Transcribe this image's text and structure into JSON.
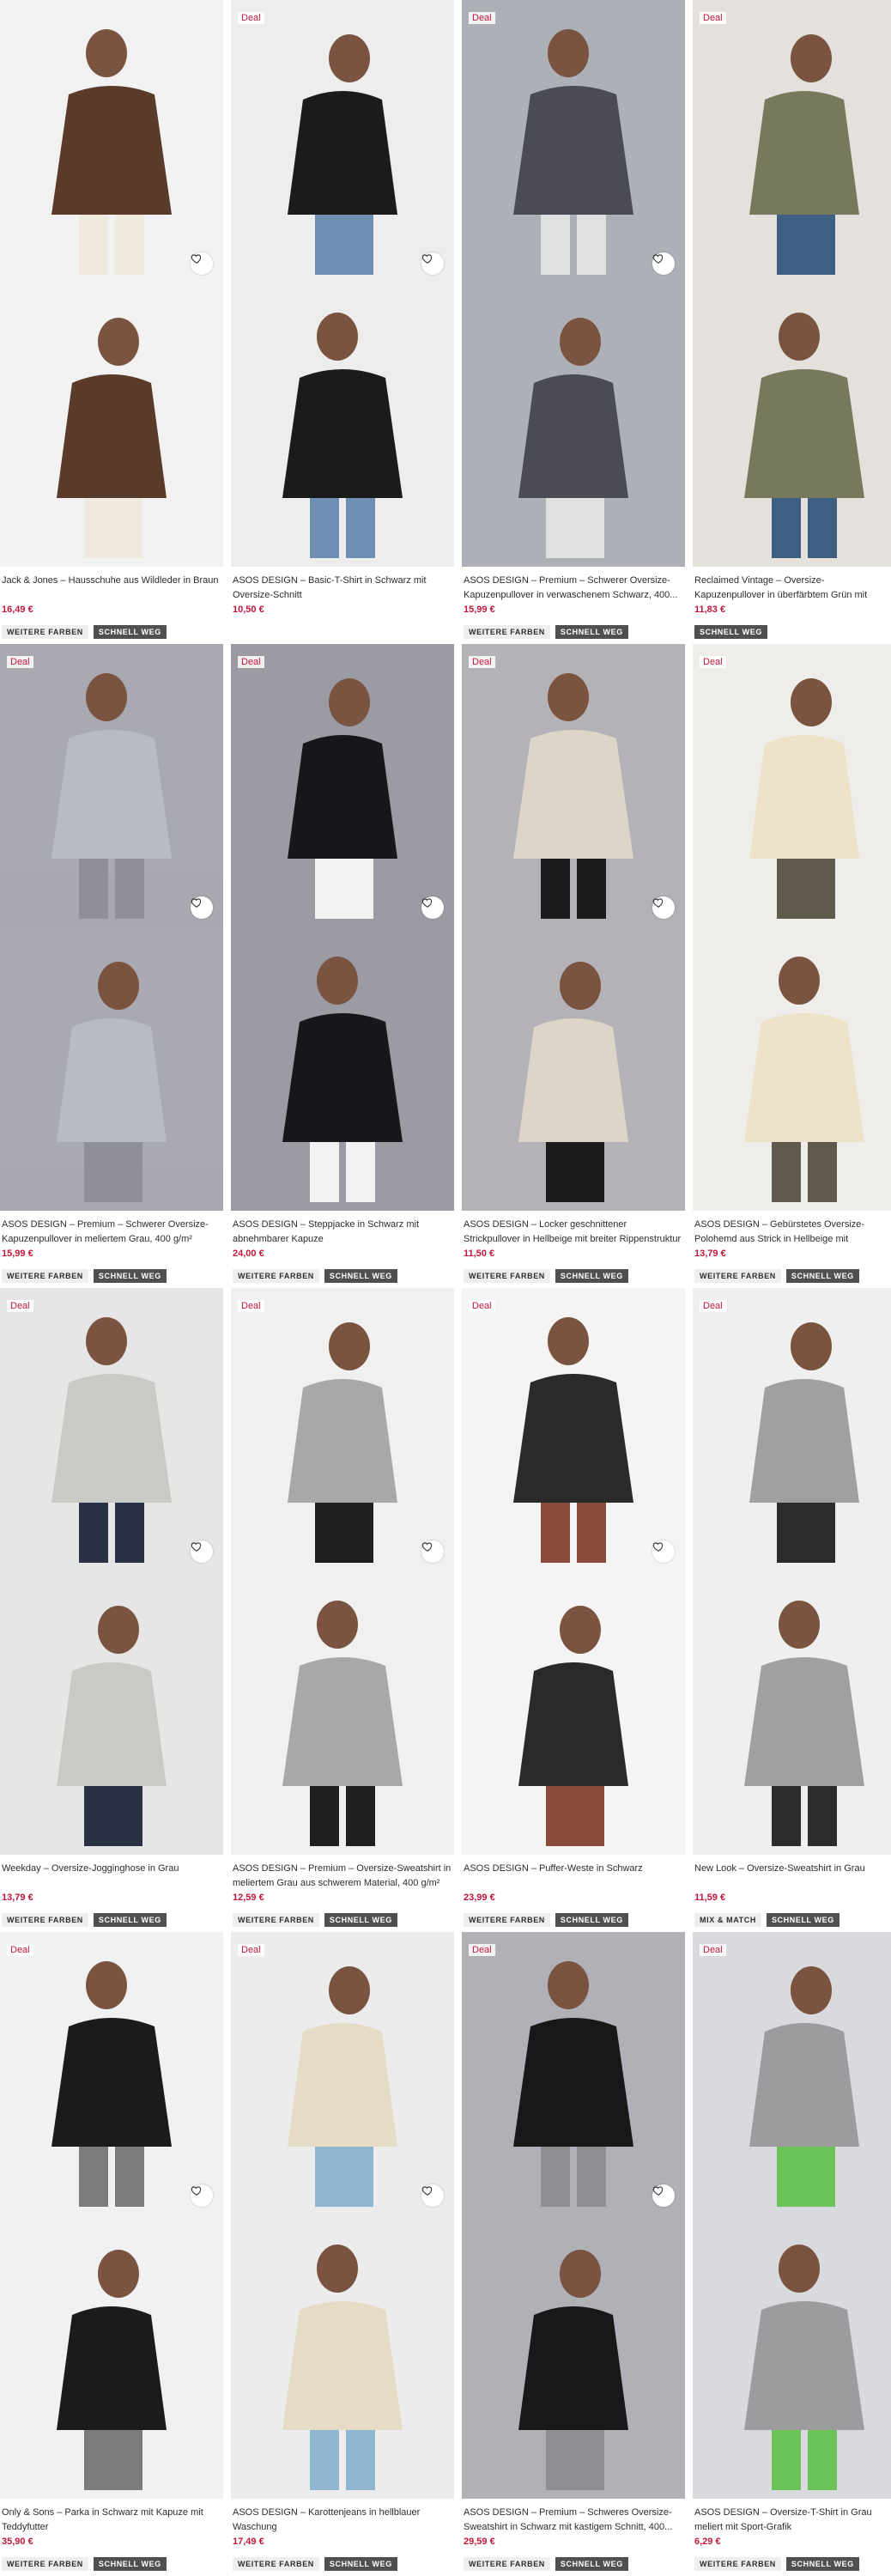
{
  "labels": {
    "deal": "Deal",
    "more_colors": "WEITERE FARBEN",
    "fast": "SCHNELL WEG",
    "mix_match": "MIX & MATCH"
  },
  "icons": {
    "wishlist": "heart-outline-icon"
  },
  "colors": {
    "price": "#c0183b",
    "deal": "#c0183b",
    "badge_dark": "#505050",
    "badge_light": "#eeeeee"
  },
  "products": [
    {
      "name": "Jack & Jones – Hausschuhe aus Wildleder in Braun",
      "price": "16,49 €",
      "deal": false,
      "badges": [
        "more_colors",
        "fast"
      ]
    },
    {
      "name": "ASOS DESIGN – Basic-T-Shirt in Schwarz mit Oversize-Schnitt",
      "price": "10,50 €",
      "deal": true,
      "badges": []
    },
    {
      "name": "ASOS DESIGN – Premium – Schwerer Oversize-Kapuzenpullover in verwaschenem Schwarz, 400...",
      "price": "15,99 €",
      "deal": true,
      "badges": [
        "more_colors",
        "fast"
      ]
    },
    {
      "name": "Reclaimed Vintage – Oversize-Kapuzenpullover in überfärbtem Grün mit Unisex-Schnitt",
      "price": "11,83 €",
      "deal": true,
      "badges": [
        "fast"
      ]
    },
    {
      "name": "ASOS DESIGN – Premium – Schwerer Oversize-Kapuzenpullover in meliertem Grau, 400 g/m²",
      "price": "15,99 €",
      "deal": true,
      "badges": [
        "more_colors",
        "fast"
      ]
    },
    {
      "name": "ASOS DESIGN – Steppjacke in Schwarz mit abnehmbarer Kapuze",
      "price": "24,00 €",
      "deal": true,
      "badges": [
        "more_colors",
        "fast"
      ]
    },
    {
      "name": "ASOS DESIGN – Locker geschnittener Strickpullover in Hellbeige mit breiter Rippenstruktur",
      "price": "11,50 €",
      "deal": true,
      "badges": [
        "more_colors",
        "fast"
      ]
    },
    {
      "name": "ASOS DESIGN – Gebürstetes Oversize-Polohemd aus Strick in Hellbeige mit Einkerbung am Ausschnitt",
      "price": "13,79 €",
      "deal": true,
      "badges": [
        "more_colors",
        "fast"
      ]
    },
    {
      "name": "Weekday – Oversize-Jogginghose in Grau",
      "price": "13,79 €",
      "deal": true,
      "badges": [
        "more_colors",
        "fast"
      ]
    },
    {
      "name": "ASOS DESIGN – Premium – Oversize-Sweatshirt in meliertem Grau aus schwerem Material, 400 g/m²",
      "price": "12,59 €",
      "deal": true,
      "badges": [
        "more_colors",
        "fast"
      ]
    },
    {
      "name": "ASOS DESIGN – Puffer-Weste in Schwarz",
      "price": "23,99 €",
      "deal": true,
      "badges": [
        "more_colors",
        "fast"
      ]
    },
    {
      "name": "New Look – Oversize-Sweatshirt in Grau",
      "price": "11,59 €",
      "deal": true,
      "badges": [
        "mix_match",
        "fast"
      ]
    },
    {
      "name": "Only & Sons – Parka in Schwarz mit Kapuze mit Teddyfutter",
      "price": "35,90 €",
      "deal": true,
      "badges": [
        "more_colors",
        "fast"
      ]
    },
    {
      "name": "ASOS DESIGN – Karottenjeans in hellblauer Waschung",
      "price": "17,49 €",
      "deal": true,
      "badges": [
        "more_colors",
        "fast"
      ]
    },
    {
      "name": "ASOS DESIGN – Premium – Schweres Oversize-Sweatshirt in Schwarz mit kastigem Schnitt, 400...",
      "price": "29,59 €",
      "deal": true,
      "badges": [
        "more_colors",
        "fast"
      ]
    },
    {
      "name": "ASOS DESIGN – Oversize-T-Shirt in Grau meliert mit Sport-Grafik",
      "price": "6,29 €",
      "deal": true,
      "badges": [
        "more_colors",
        "fast"
      ]
    }
  ]
}
